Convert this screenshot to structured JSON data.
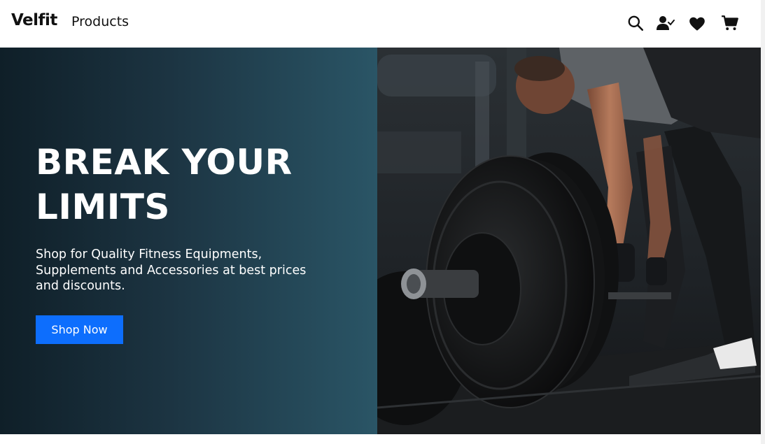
{
  "navbar": {
    "brand": "Velfit",
    "link_products": "Products",
    "icons": [
      "search-icon",
      "user-check-icon",
      "heart-icon",
      "cart-icon"
    ]
  },
  "hero": {
    "title": "BREAK YOUR LIMITS",
    "subtitle": "Shop for Quality Fitness Equipments, Supplements and Accessories at best prices and discounts.",
    "button_label": "Shop Now",
    "image_subject": "athlete deadlifting a loaded barbell in a gym"
  },
  "colors": {
    "accent": "#0d6efd",
    "hero_dark": "#0f1f28",
    "hero_light": "#2a5566",
    "text_dark": "#111111"
  }
}
